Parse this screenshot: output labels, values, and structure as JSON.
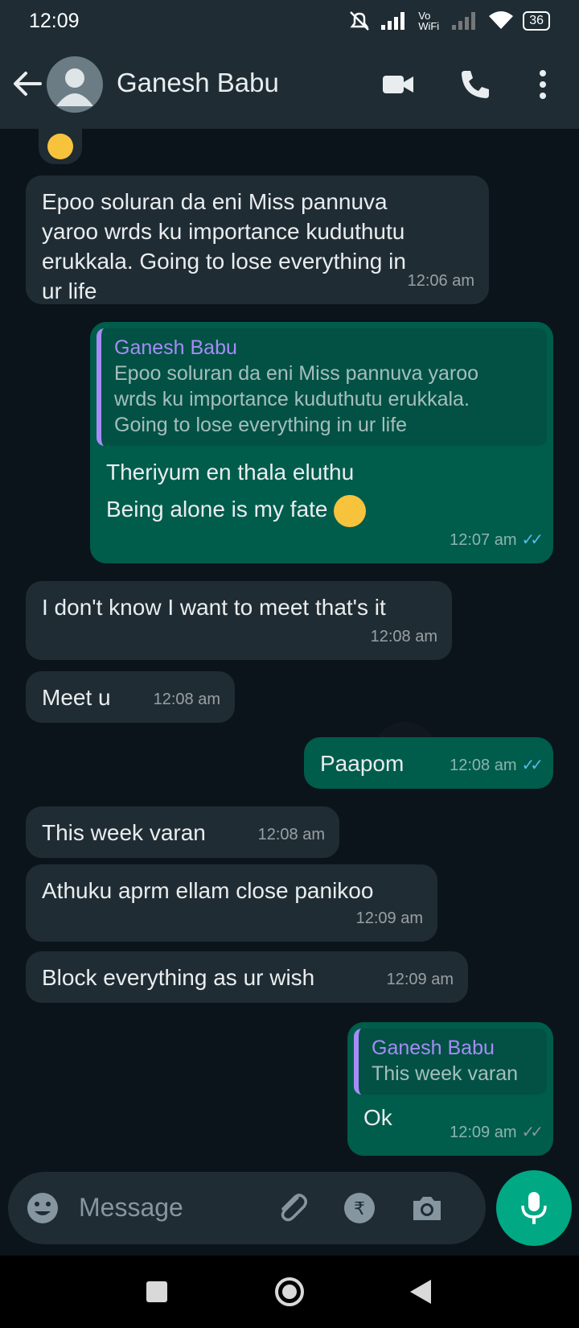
{
  "status_bar": {
    "time": "12:09",
    "network_label": "Vo WiFi",
    "battery": "36"
  },
  "header": {
    "contact_name": "Ganesh Babu"
  },
  "messages": [
    {
      "type": "in",
      "text_lines": [
        "Epoo soluran da eni Miss pannuva",
        "yaroo wrds ku importance kuduthutu",
        "erukkala. Going to lose everything in",
        "ur life"
      ],
      "time": "12:06 am"
    },
    {
      "type": "out",
      "quote_author": "Ganesh Babu",
      "quote_lines": [
        "Epoo soluran da eni Miss pannuva yaroo",
        "wrds ku importance kuduthutu erukkala.",
        "Going to lose everything in ur life"
      ],
      "text_lines": [
        "Theriyum en thala eluthu",
        "Being alone is my fate"
      ],
      "time": "12:07 am"
    },
    {
      "type": "in",
      "text": "I don't know I want to meet that's it",
      "time": "12:08 am"
    },
    {
      "type": "in",
      "text": "Meet u",
      "time": "12:08 am"
    },
    {
      "type": "out",
      "text": "Paapom",
      "time": "12:08 am"
    },
    {
      "type": "in",
      "text": "This week varan",
      "time": "12:08 am"
    },
    {
      "type": "in",
      "text": "Athuku aprm ellam close panikoo",
      "time": "12:09 am"
    },
    {
      "type": "in",
      "text": "Block everything as ur wish",
      "time": "12:09 am"
    },
    {
      "type": "out",
      "quote_author": "Ganesh Babu",
      "quote_text": "This week varan",
      "text": "Ok",
      "time": "12:09 am"
    }
  ],
  "composer": {
    "placeholder": "Message"
  },
  "colors": {
    "incoming": "#202c33",
    "outgoing": "#005c4b",
    "accent": "#00a884",
    "quote_author": "#a68cf7",
    "read_tick": "#53bdeb"
  }
}
